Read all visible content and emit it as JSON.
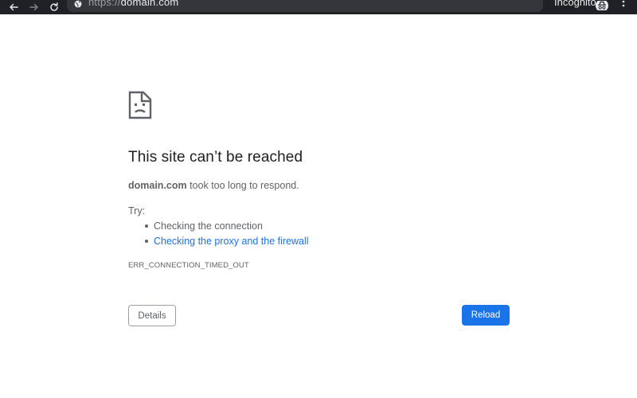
{
  "browser": {
    "url_scheme": "https://",
    "url_host": "domain.com",
    "incognito_label": "Incognito",
    "nav_icons": [
      "back-arrow-icon",
      "forward-arrow-icon",
      "reload-icon"
    ],
    "omnibox_icon": "globe-icon",
    "profile_icon": "incognito-icon",
    "menu_icon": "three-dots-menu-icon",
    "colors": {
      "toolbar": "#202124",
      "omnibox": "#35363a",
      "text": "#e8eaed"
    }
  },
  "error_page": {
    "icon": "sad-page-icon",
    "title": "This site can’t be reached",
    "host": "domain.com",
    "message": " took too long to respond.",
    "try_label": "Try:",
    "suggestions": [
      {
        "text": "Checking the connection",
        "is_link": false
      },
      {
        "text": "Checking the proxy and the firewall",
        "is_link": true
      }
    ],
    "error_code": "ERR_CONNECTION_TIMED_OUT",
    "details_button": "Details",
    "reload_button": "Reload",
    "colors": {
      "heading": "#202124",
      "body_text": "#5f6368",
      "link": "#1a73e8",
      "primary_button": "#1a73e8"
    }
  }
}
